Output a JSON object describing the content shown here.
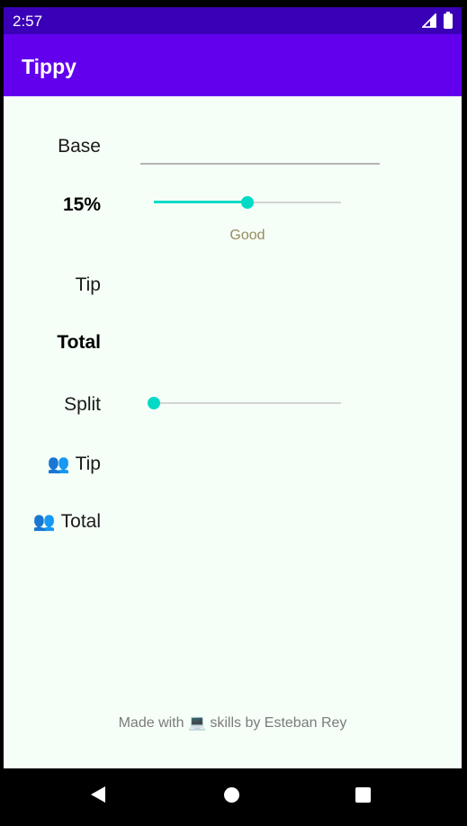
{
  "status_bar": {
    "time": "2:57",
    "icons": [
      "signal-icon",
      "battery-icon"
    ]
  },
  "app_bar": {
    "title": "Tippy"
  },
  "form": {
    "base_label": "Base",
    "base_value": "",
    "tip_percent_label": "15%",
    "tip_percent_slider_value": 0.5,
    "tip_description": "Good",
    "tip_label": "Tip",
    "tip_value": "",
    "total_label": "Total",
    "total_value": "",
    "split_label": "Split",
    "split_slider_value": 0.0,
    "per_person_tip_icon": "people-icon",
    "per_person_tip_label": "Tip",
    "per_person_total_icon": "people-icon",
    "per_person_total_label": "Total"
  },
  "footer": {
    "text": "Made with 💻 skills by Esteban Rey"
  },
  "colors": {
    "status_bar": "#3a00b8",
    "app_bar": "#6200ee",
    "accent": "#03dac5",
    "background": "#f5fff7",
    "tip_description": "#9a8a5e"
  }
}
